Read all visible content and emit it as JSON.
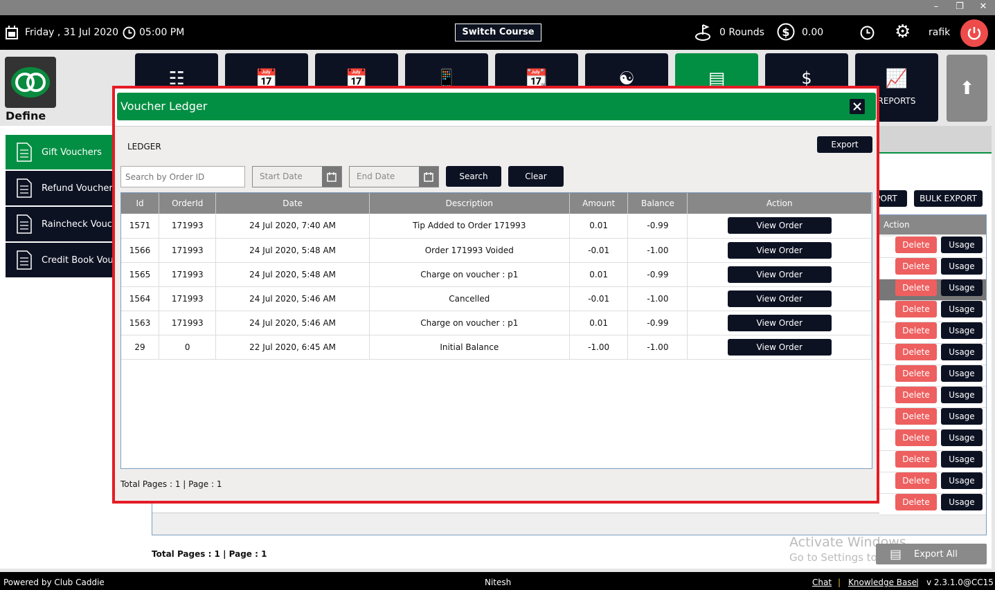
{
  "window": {
    "controls": [
      "minimize",
      "restore",
      "close"
    ]
  },
  "topbar": {
    "date": "Friday ,  31 Jul 2020",
    "time": "05:00 PM",
    "switch_course": "Switch Course",
    "rounds": "0 Rounds",
    "balance": "0.00",
    "user": "rafik"
  },
  "define": {
    "label": "Define"
  },
  "nav_tiles": [
    {
      "icon": "barcode-scanner-icon",
      "label": ""
    },
    {
      "icon": "calendar-icon",
      "label": ""
    },
    {
      "icon": "calendar-list-icon",
      "label": ""
    },
    {
      "icon": "mobile-user-icon",
      "label": ""
    },
    {
      "icon": "calendar-grid-icon",
      "label": ""
    },
    {
      "icon": "members-icon",
      "label": ""
    },
    {
      "icon": "vouchers-icon",
      "label": "",
      "active": true
    },
    {
      "icon": "cash-register-icon",
      "label": ""
    },
    {
      "icon": "reports-icon",
      "label": "REPORTS"
    }
  ],
  "sidebar": {
    "items": [
      {
        "label": "Gift Vouchers",
        "active": true
      },
      {
        "label": "Refund Vouchers"
      },
      {
        "label": "Raincheck Vouchers"
      },
      {
        "label": "Credit Book Vouchers"
      }
    ]
  },
  "background": {
    "export_partial": "PORT",
    "bulk_export": "BULK EXPORT",
    "action_header": "Action",
    "delete_label": "Delete",
    "usage_label": "Usage",
    "row_count": 13,
    "total_pages": "Total Pages : 1 | Page : 1",
    "export_all": "Export All"
  },
  "activate": {
    "line1": "Activate Windows",
    "line2": "Go to Settings to activate Windows."
  },
  "footer": {
    "powered": "Powered by Club Caddie",
    "user": "Nitesh",
    "chat": "Chat",
    "kb": "Knowledge Base",
    "version": "v 2.3.1.0@CC15",
    "sep": "|"
  },
  "modal": {
    "title": "Voucher Ledger",
    "ledger_label": "LEDGER",
    "export": "Export",
    "search_placeholder": "Search by Order ID",
    "start_date": "Start Date",
    "end_date": "End Date",
    "search": "Search",
    "clear": "Clear",
    "columns": [
      "Id",
      "OrderId",
      "Date",
      "Description",
      "Amount",
      "Balance",
      "Action"
    ],
    "rows": [
      [
        "1571",
        "171993",
        "24 Jul 2020, 7:40 AM",
        "Tip Added to Order 171993",
        "0.01",
        "-0.99",
        "View Order"
      ],
      [
        "1566",
        "171993",
        "24 Jul 2020, 5:48 AM",
        "Order 171993 Voided",
        "-0.01",
        "-1.00",
        "View Order"
      ],
      [
        "1565",
        "171993",
        "24 Jul 2020, 5:48 AM",
        "Charge on voucher : p1",
        "0.01",
        "-0.99",
        "View Order"
      ],
      [
        "1564",
        "171993",
        "24 Jul 2020, 5:46 AM",
        "Cancelled",
        "-0.01",
        "-1.00",
        "View Order"
      ],
      [
        "1563",
        "171993",
        "24 Jul 2020, 5:46 AM",
        "Charge on voucher : p1",
        "0.01",
        "-0.99",
        "View Order"
      ],
      [
        "29",
        "0",
        "22 Jul 2020, 6:45 AM",
        "Initial Balance",
        "-1.00",
        "-1.00",
        "View Order"
      ]
    ],
    "pages": "Total Pages : 1 | Page : 1"
  },
  "colors": {
    "green": "#038f43",
    "navy": "#0d1223",
    "red": "#e51b24",
    "delete": "#ee5f5f"
  }
}
